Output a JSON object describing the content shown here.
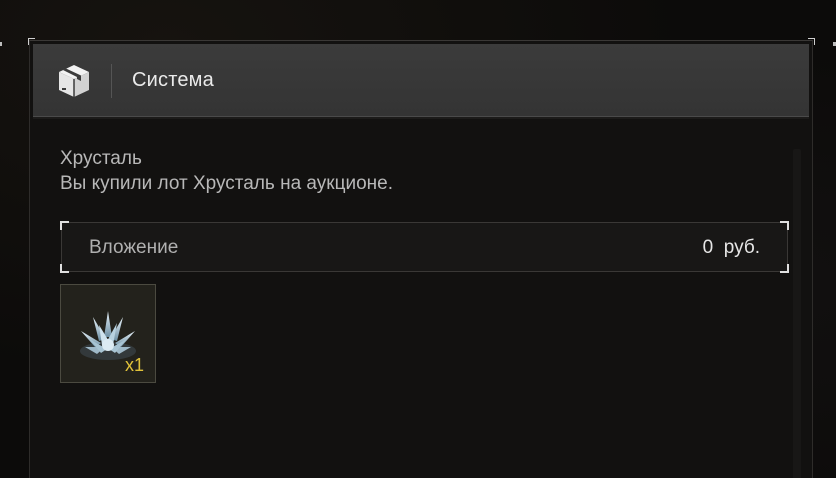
{
  "header": {
    "icon": "box-icon",
    "title": "Система"
  },
  "message": {
    "title": "Хрусталь",
    "body": "Вы купили лот Хрусталь на аукционе."
  },
  "attachment": {
    "label": "Вложение",
    "value": "0  руб."
  },
  "items": [
    {
      "icon": "crystal-icon",
      "quantity": "x1"
    }
  ],
  "colors": {
    "header_bg": "#383838",
    "panel_bg": "#121110",
    "quantity": "#e0c23a",
    "text": "#b8b8b8"
  }
}
